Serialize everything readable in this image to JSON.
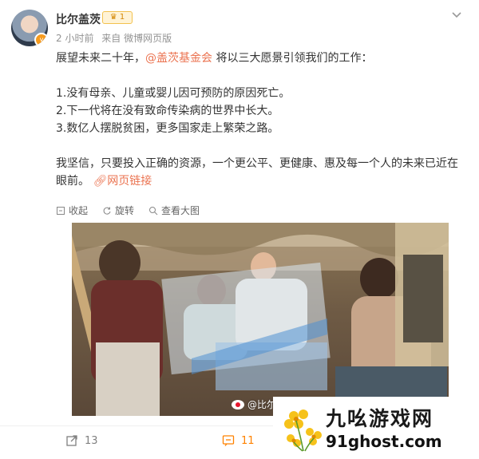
{
  "author": {
    "name": "比尔盖茨",
    "badge": "1",
    "time": "2 小时前",
    "source": "来自 微博网页版"
  },
  "post": {
    "intro_before": "展望未来二十年，",
    "mention": "@盖茨基金会",
    "intro_after": " 将以三大愿景引领我们的工作：",
    "item1": "1.没有母亲、儿童或婴儿因可预防的原因死亡。",
    "item2": "2.下一代将在没有致命传染病的世界中长大。",
    "item3": "3.数亿人摆脱贫困，更多国家走上繁荣之路。",
    "closing": "我坚信，只要投入正确的资源，一个更公平、更健康、惠及每一个人的未来已近在眼前。",
    "web_link": "网页链接"
  },
  "image_actions": {
    "collapse": "收起",
    "rotate": "旋转",
    "view_large": "查看大图"
  },
  "watermark": "@比尔",
  "footer": {
    "repost_count": "13",
    "comment_count": "11"
  },
  "site_logo": {
    "name": "九吆游戏网",
    "url": "91ghost.com"
  },
  "colors": {
    "link": "#eb7350",
    "comment_active": "#ff8200"
  }
}
